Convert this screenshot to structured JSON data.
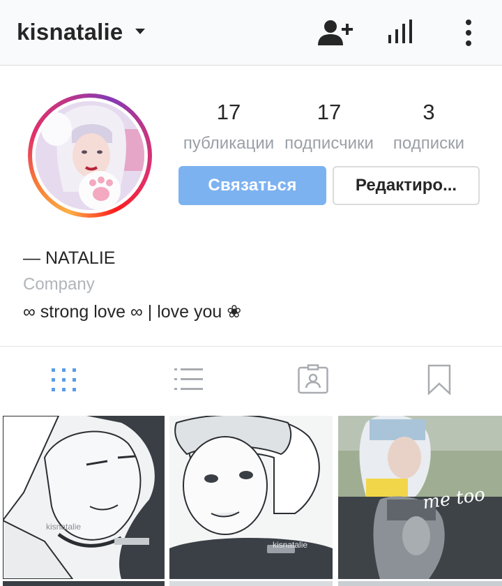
{
  "header": {
    "username": "kisnatalie",
    "dropdown_icon": "caret-down-icon",
    "icons": [
      "add-person-icon",
      "stats-icon",
      "more-vertical-icon"
    ]
  },
  "profile": {
    "stats": {
      "posts": {
        "value": "17",
        "label": "публикации"
      },
      "followers": {
        "value": "17",
        "label": "подписчики"
      },
      "following": {
        "value": "3",
        "label": "подписки"
      }
    },
    "buttons": {
      "contact": "Связаться",
      "edit": "Редактиро..."
    },
    "bio": {
      "name": "— NATALIE",
      "category": "Company",
      "text": "∞ strong love ∞ | love you  ❀"
    }
  },
  "tabs": [
    {
      "name": "grid",
      "icon": "grid-icon",
      "active": true
    },
    {
      "name": "list",
      "icon": "list-icon",
      "active": false
    },
    {
      "name": "tagged",
      "icon": "tagged-person-icon",
      "active": false
    },
    {
      "name": "saved",
      "icon": "bookmark-icon",
      "active": false
    }
  ],
  "posts": {
    "watermark1": "kisnatalie",
    "watermark2": "kisnatalie",
    "overlay3": "me too"
  },
  "colors": {
    "accent_blue": "#7db2f0",
    "grid_active": "#5b9ce6",
    "icon_gray": "#a8acb0"
  }
}
